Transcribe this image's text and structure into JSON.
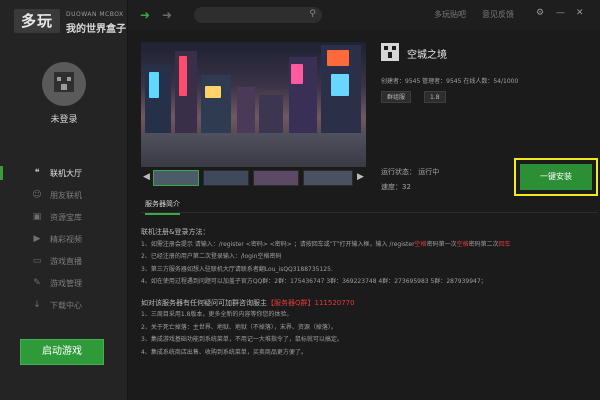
{
  "brand": {
    "logo_text": "多玩",
    "tagline_en": "DUOWAN MCBOX",
    "tagline_cn": "我的世界盒子"
  },
  "sidebar": {
    "login_status": "未登录",
    "items": [
      {
        "label": "联机大厅",
        "icon": "chat-icon",
        "active": true
      },
      {
        "label": "朋友联机",
        "icon": "friends-icon",
        "active": false
      },
      {
        "label": "资源宝库",
        "icon": "treasure-icon",
        "active": false
      },
      {
        "label": "精彩视频",
        "icon": "video-icon",
        "active": false
      },
      {
        "label": "游戏直播",
        "icon": "live-icon",
        "active": false
      },
      {
        "label": "游戏管理",
        "icon": "manage-icon",
        "active": false
      },
      {
        "label": "下载中心",
        "icon": "download-icon",
        "active": false
      }
    ],
    "start_button": "启动游戏"
  },
  "topbar": {
    "search_placeholder": "",
    "links": [
      "多玩贴吧",
      "意见反馈"
    ],
    "controls": [
      "gear-icon",
      "minimize-icon",
      "close-icon"
    ]
  },
  "server": {
    "name": "空城之境",
    "meta": "创建者：9545   管理者：9545   在线人数：54/1000",
    "tags": [
      "群组服",
      "1.8"
    ],
    "run_status": "运行状态： 运行中",
    "speed": "速度：32",
    "install_button": "一键安装"
  },
  "tabs": {
    "intro": "服务器简介"
  },
  "description": {
    "lines": [
      "联机注册&登录方法：",
      "1、如需注册会提示 请输入：/register <密码> <密码> ；请按回车或“T”打开输入框，输入 /register",
      "2、已经注册的用户第二次登录输入：/login空格密码",
      "3、第三方服务器如想入驻联机大厅请联系者翻Lou_isQQ3188735125.",
      "4、如在使用过程遇到问题可以加盖子官方QQ群：2群：175436747 3群：369223748 4群：273695983 5群：287939947；",
      "如对该服务器有任何疑问可加群咨询服主",
      "1、三周目采用1.8版本，更多全新的内容等你您的体验。",
      "2、关于死亡掉落：主世界、地狱、地狱（不掉落），末界、资源（掉落）。",
      "3、集成游戏基础功能到系统菜单，不用记一大堆指令了，鼠标就可以搞定。",
      "4、集成系统商店出售、收购到系统菜单，买卖商品更方便了。"
    ],
    "line1_red_a": "空格",
    "line1_mid": "密码第一次",
    "line1_red_b": "空格",
    "line1_tail": "密码第二次",
    "line1_red_c": "回车",
    "qq_group": "【服务器Q群】111520770"
  },
  "colors": {
    "accent_green": "#2e9a3a",
    "highlight_yellow": "#f2ea1a",
    "warning_red": "#e03a3a"
  }
}
